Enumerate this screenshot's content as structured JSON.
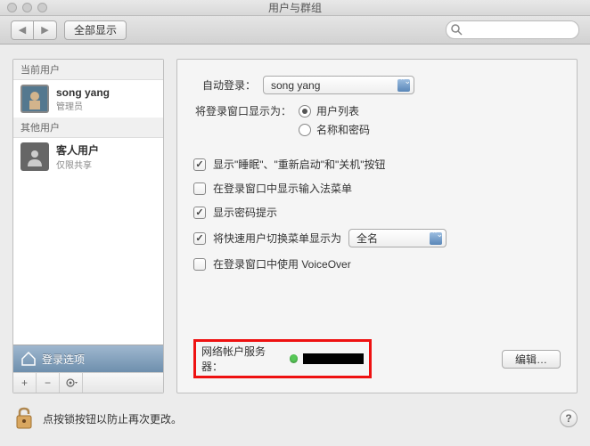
{
  "window": {
    "title": "用户与群组"
  },
  "toolbar": {
    "show_all": "全部显示",
    "search_placeholder": ""
  },
  "sidebar": {
    "section_current": "当前用户",
    "section_other": "其他用户",
    "users": [
      {
        "name": "song yang",
        "role": "管理员"
      },
      {
        "name": "客人用户",
        "role": "仅限共享"
      }
    ],
    "login_options": "登录选项"
  },
  "main": {
    "auto_login_label": "自动登录：",
    "auto_login_value": "song yang",
    "display_as_label": "将登录窗口显示为：",
    "radio_userlist": "用户列表",
    "radio_namepw": "名称和密码",
    "chk_sleep": "显示\"睡眠\"、\"重新启动\"和\"关机\"按钮",
    "chk_input": "在登录窗口中显示输入法菜单",
    "chk_pwhint": "显示密码提示",
    "chk_fastswitch": "将快速用户切换菜单显示为",
    "fastswitch_value": "全名",
    "chk_voiceover": "在登录窗口中使用 VoiceOver",
    "net_label": "网络帐户服务器：",
    "edit_btn": "编辑…"
  },
  "footer": {
    "lock_text": "点按锁按钮以防止再次更改。"
  }
}
